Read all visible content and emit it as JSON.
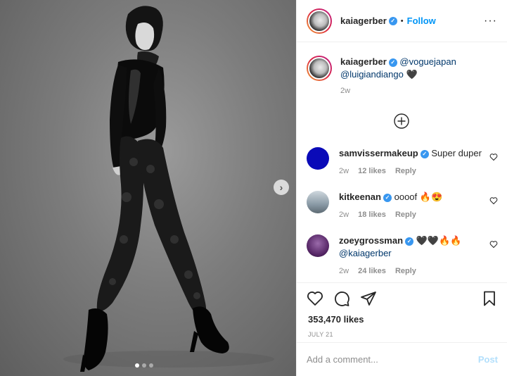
{
  "post": {
    "image_alt_subject": "",
    "carousel_next_icon": "chevron-right-icon",
    "carousel_dots": 3,
    "carousel_active_dot": 1
  },
  "header": {
    "username": "kaiagerber",
    "separator": "•",
    "follow_label": "Follow",
    "more_icon": "ellipsis-icon"
  },
  "caption": {
    "username": "kaiagerber",
    "mention1": "@voguejapan",
    "mention2": "@luigiandiango",
    "emoji": "🖤",
    "time": "2w"
  },
  "load_more_icon": "plus-circle-icon",
  "comments": [
    {
      "username": "samvissermakeup",
      "text": "Super duper",
      "time": "2w",
      "likes": "12 likes",
      "reply": "Reply",
      "avatar_color": "#0a0ab8"
    },
    {
      "username": "kitkeenan",
      "text": "oooof 🔥😍",
      "time": "2w",
      "likes": "18 likes",
      "reply": "Reply",
      "avatar_color": "#8a9aa6"
    },
    {
      "username": "zoeygrossman",
      "text": "🖤🖤🔥🔥",
      "mention": "@kaiagerber",
      "time": "2w",
      "likes": "24 likes",
      "reply": "Reply",
      "avatar_color": "#5a2a6a"
    }
  ],
  "actions": {
    "like_icon": "heart-icon",
    "comment_icon": "comment-icon",
    "share_icon": "share-icon",
    "save_icon": "bookmark-icon"
  },
  "likes_count": "353,470 likes",
  "date": "JULY 21",
  "add_comment": {
    "placeholder": "Add a comment...",
    "post_label": "Post"
  },
  "colors": {
    "link_blue": "#0095f6",
    "mention_blue": "#00376b",
    "verified_blue": "#3897f0",
    "muted_gray": "#8e8e8e",
    "post_disabled": "#b2dffc"
  }
}
